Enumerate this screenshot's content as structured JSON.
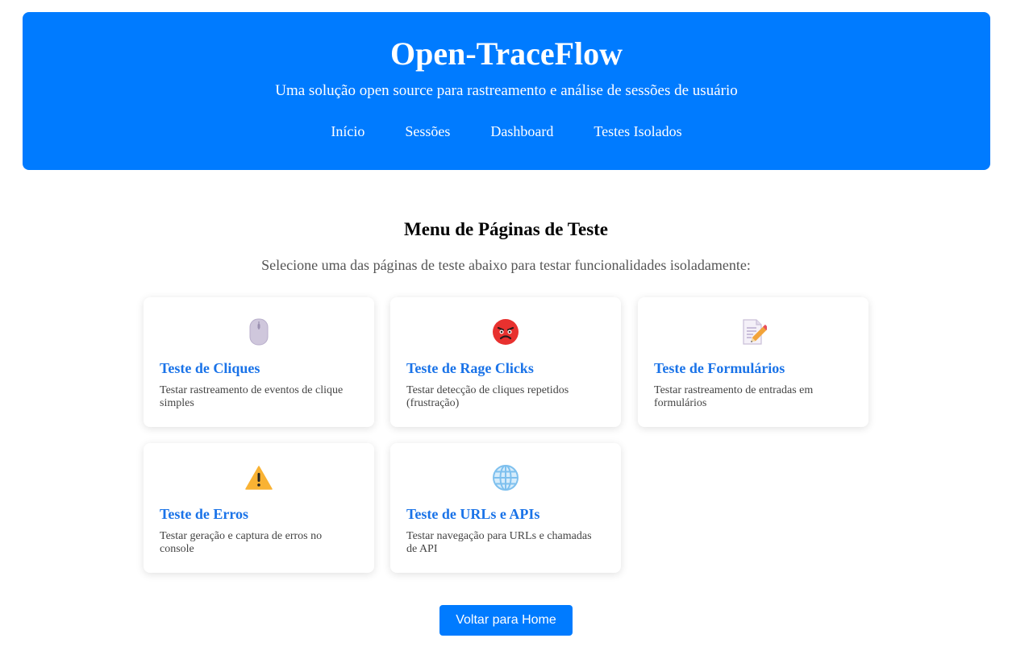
{
  "header": {
    "title": "Open-TraceFlow",
    "subtitle": "Uma solução open source para rastreamento e análise de sessões de usuário",
    "nav": [
      {
        "label": "Início"
      },
      {
        "label": "Sessões"
      },
      {
        "label": "Dashboard"
      },
      {
        "label": "Testes Isolados"
      }
    ]
  },
  "main": {
    "title": "Menu de Páginas de Teste",
    "description": "Selecione uma das páginas de teste abaixo para testar funcionalidades isoladamente:",
    "cards": [
      {
        "icon": "computer-mouse-icon",
        "title": "Teste de Cliques",
        "description": "Testar rastreamento de eventos de clique simples"
      },
      {
        "icon": "angry-face-icon",
        "title": "Teste de Rage Clicks",
        "description": "Testar detecção de cliques repetidos (frustração)"
      },
      {
        "icon": "memo-pencil-icon",
        "title": "Teste de Formulários",
        "description": "Testar rastreamento de entradas em formulários"
      },
      {
        "icon": "warning-icon",
        "title": "Teste de Erros",
        "description": "Testar geração e captura de erros no console"
      },
      {
        "icon": "globe-icon",
        "title": "Teste de URLs e APIs",
        "description": "Testar navegação para URLs e chamadas de API"
      }
    ],
    "back_button": "Voltar para Home"
  },
  "colors": {
    "header_bg": "#007bff",
    "card_title": "#1a73e8",
    "button_bg": "#007bff"
  }
}
